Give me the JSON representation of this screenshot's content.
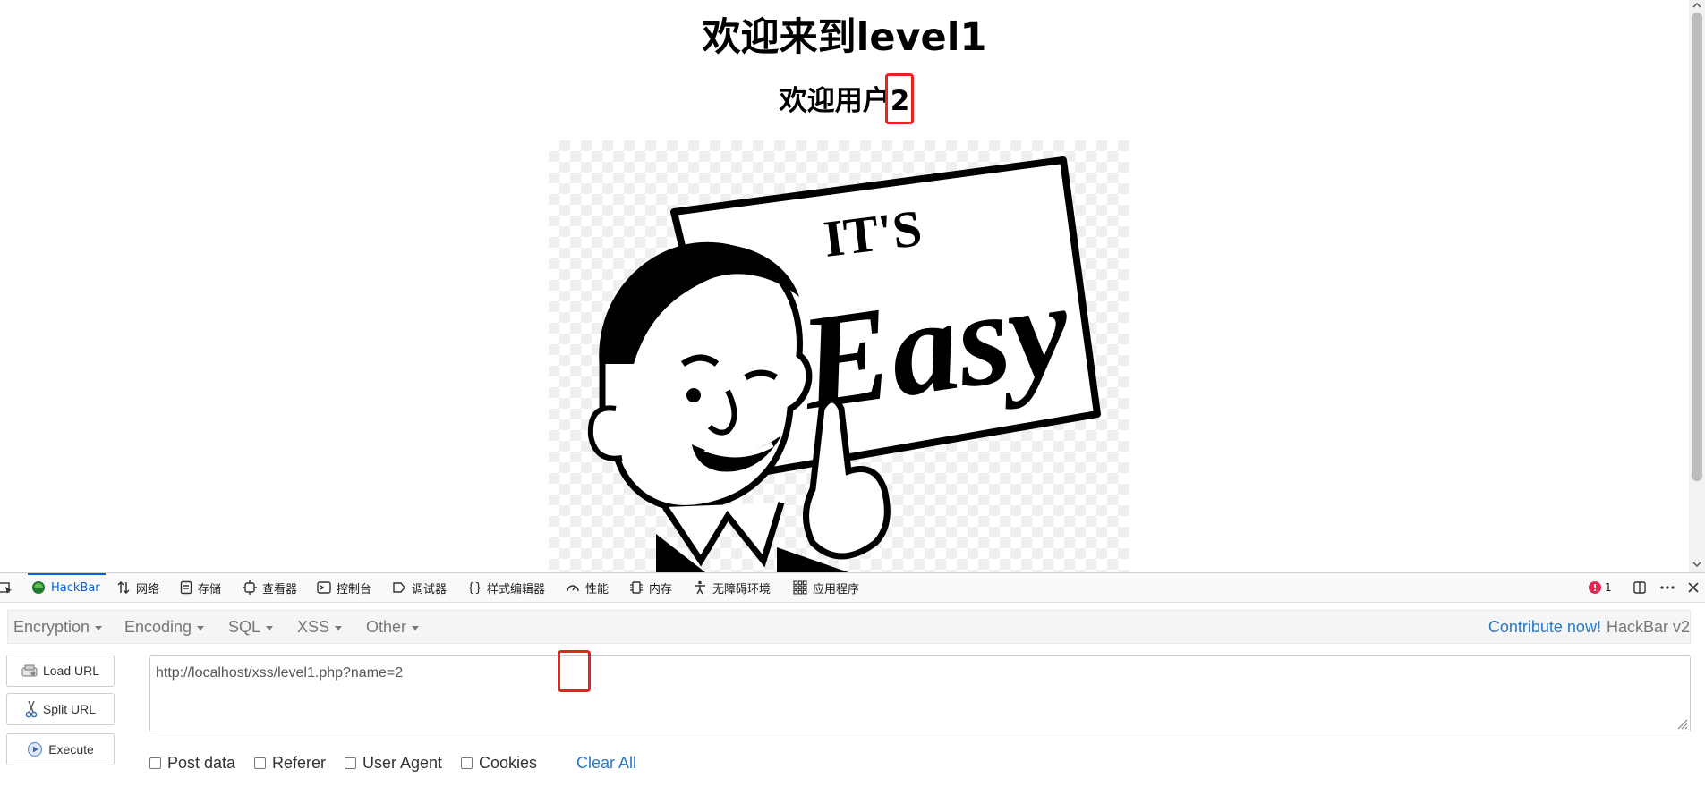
{
  "page": {
    "title": "欢迎来到level1",
    "welcome_prefix": "欢迎用户",
    "user_name": "2",
    "image": {
      "sign_top": "IT'S",
      "sign_bottom": "Easy"
    }
  },
  "devtools": {
    "tabs": [
      {
        "label": "HackBar",
        "icon": "hackbar-icon",
        "active": true
      },
      {
        "label": "网络",
        "icon": "network-icon"
      },
      {
        "label": "存储",
        "icon": "storage-icon"
      },
      {
        "label": "查看器",
        "icon": "inspector-icon"
      },
      {
        "label": "控制台",
        "icon": "console-icon"
      },
      {
        "label": "调试器",
        "icon": "debugger-icon"
      },
      {
        "label": "样式编辑器",
        "icon": "style-editor-icon"
      },
      {
        "label": "性能",
        "icon": "performance-icon"
      },
      {
        "label": "内存",
        "icon": "memory-icon"
      },
      {
        "label": "无障碍环境",
        "icon": "accessibility-icon"
      },
      {
        "label": "应用程序",
        "icon": "application-icon"
      }
    ],
    "error_count": "1",
    "accent_color": "#0061e0"
  },
  "hackbar": {
    "menus": [
      {
        "label": "Encryption"
      },
      {
        "label": "Encoding"
      },
      {
        "label": "SQL"
      },
      {
        "label": "XSS"
      },
      {
        "label": "Other"
      }
    ],
    "contribute_label": "Contribute now!",
    "version_label": "HackBar v2",
    "buttons": {
      "load_url": "Load URL",
      "split_url": "Split URL",
      "execute": "Execute"
    },
    "url_prefix": "http://localhost/xss/level1.php?name=",
    "url_value": "2",
    "checkboxes": [
      {
        "label": "Post data",
        "checked": false
      },
      {
        "label": "Referer",
        "checked": false
      },
      {
        "label": "User Agent",
        "checked": false
      },
      {
        "label": "Cookies",
        "checked": false
      }
    ],
    "clear_all_label": "Clear All",
    "link_color": "#2a78c4"
  },
  "highlight_color": "#e8231f"
}
